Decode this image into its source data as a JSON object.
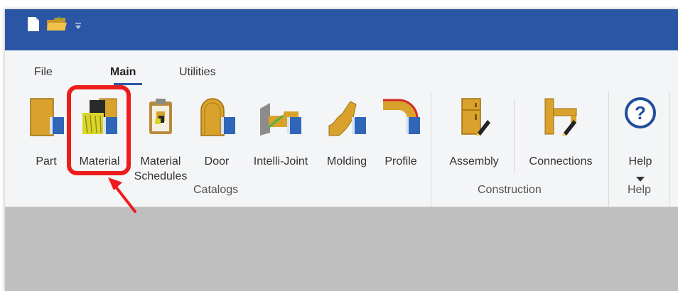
{
  "colors": {
    "titlebar": "#2b56a5",
    "ribbon": "#f4f5f7",
    "workspace": "#bfbfbf",
    "accent": "#2b56a5",
    "highlight": "#ee1c1c",
    "icon_gold": "#d9a22c"
  },
  "quick_access": {
    "new_icon": "new-file-icon",
    "open_icon": "open-folder-icon",
    "customize_icon": "customize-dropdown-icon"
  },
  "tabs": [
    {
      "label": "File"
    },
    {
      "label": "Main",
      "active": true
    },
    {
      "label": "Utilities"
    }
  ],
  "groups": {
    "catalogs": {
      "label": "Catalogs",
      "buttons": {
        "part": "Part",
        "material": "Material",
        "material_schedules_1": "Material",
        "material_schedules_2": "Schedules",
        "door": "Door",
        "intelli_joint": "Intelli-Joint",
        "molding": "Molding",
        "profile": "Profile"
      }
    },
    "construction": {
      "label": "Construction",
      "buttons": {
        "assembly": "Assembly",
        "connections": "Connections"
      }
    },
    "help": {
      "label": "Help",
      "buttons": {
        "help": "Help"
      }
    }
  }
}
